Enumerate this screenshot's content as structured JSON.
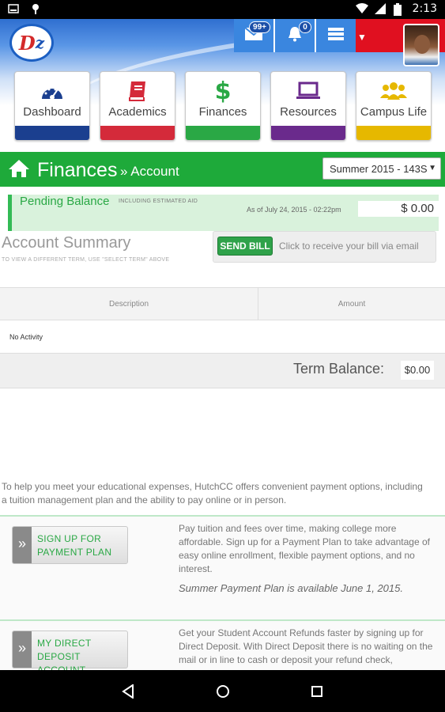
{
  "status_bar": {
    "time": "2:13"
  },
  "header": {
    "logo_text": "D",
    "logo_sub": "z",
    "mail_badge": "99+",
    "notif_badge": "0"
  },
  "nav_tiles": [
    {
      "label": "Dashboard",
      "color": "#1b3f8f",
      "icon": "gauge-icon"
    },
    {
      "label": "Academics",
      "color": "#d42a3a",
      "icon": "book-icon"
    },
    {
      "label": "Finances",
      "color": "#2aa845",
      "icon": "dollar-icon"
    },
    {
      "label": "Resources",
      "color": "#6a2a8c",
      "icon": "laptop-icon"
    },
    {
      "label": "Campus Life",
      "color": "#e6b800",
      "icon": "people-icon"
    }
  ],
  "title_bar": {
    "title": "Finances",
    "subtitle": "» Account",
    "term_selected": "Summer 2015 - 143S"
  },
  "pending": {
    "label": "Pending Balance",
    "sublabel": "INCLUDING ESTIMATED AID",
    "date": "As of July 24, 2015 - 02:22pm",
    "amount": "$ 0.00"
  },
  "account_summary": {
    "title": "Account Summary",
    "hint": "TO VIEW A DIFFERENT TERM, USE \"SELECT TERM\" ABOVE",
    "send_bill_label": "SEND BILL",
    "send_bill_text": "Click to receive your bill via email"
  },
  "table": {
    "col_description": "Description",
    "col_amount": "Amount",
    "empty_row": "No Activity",
    "term_balance_label": "Term Balance:",
    "term_balance_value": "$0.00"
  },
  "intro_text": "To help you meet your educational expenses, HutchCC offers convenient payment options, including a tuition management plan and the ability to pay online or in person.",
  "promos": [
    {
      "button_line1": "SIGN UP FOR",
      "button_line2": "PAYMENT PLAN",
      "text": "Pay tuition and fees over time, making college more affordable. Sign up for a Payment Plan to take advantage of easy online enrollment, flexible payment options, and no interest.",
      "note": "Summer Payment Plan is available June 1, 2015."
    },
    {
      "button_line1": "MY DIRECT DEPOSIT",
      "button_line2": "ACCOUNT",
      "text": "Get your Student Account Refunds faster by signing up for Direct Deposit. With Direct Deposit there is no waiting on the mail or in line to cash or deposit your refund check,"
    }
  ],
  "colors": {
    "green": "#1eaa3a",
    "header_blue": "#3a86df",
    "red": "#e01020"
  }
}
